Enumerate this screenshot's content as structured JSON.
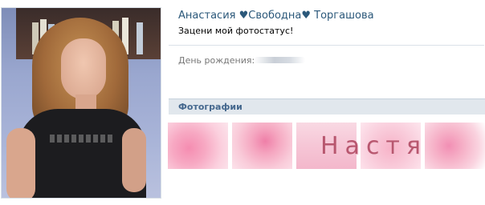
{
  "profile": {
    "name": "Анастасия ♥Свободна♥ Торгашова",
    "status": "Зацени мой фотостатус!"
  },
  "info": {
    "birthday_label": "День рождения:"
  },
  "photos_section": {
    "title": "Фотографии",
    "overlay_text": "Настя"
  },
  "colors": {
    "link": "#2b587a",
    "section_bg": "#e1e7ed",
    "section_title": "#45688e"
  }
}
